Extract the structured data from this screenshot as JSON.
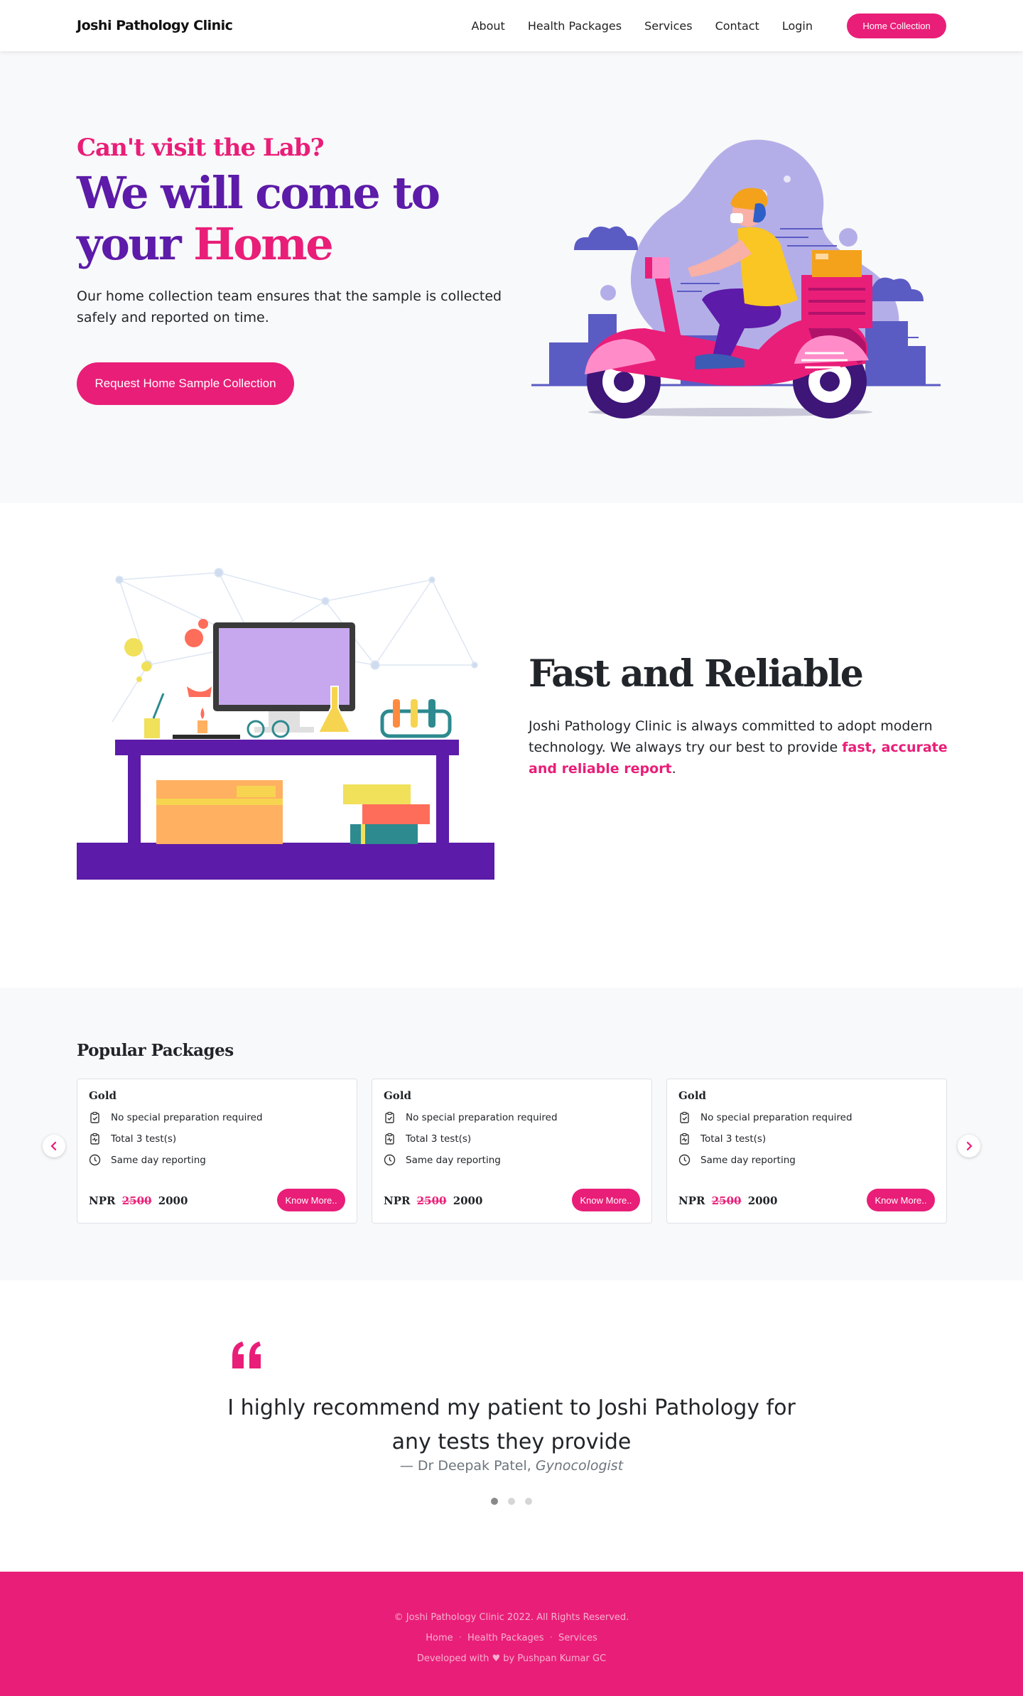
{
  "brand": "Joshi Pathology Clinic",
  "nav": {
    "items": [
      {
        "label": "About"
      },
      {
        "label": "Health Packages"
      },
      {
        "label": "Services"
      },
      {
        "label": "Contact"
      },
      {
        "label": "Login"
      }
    ],
    "cta_label": "Home Collection"
  },
  "hero": {
    "subtitle": "Can't visit the Lab?",
    "title_line1": "We will come to",
    "title_line2_a": "your ",
    "title_line2_b": "Home",
    "description": "Our home collection team ensures that the sample is collected safely and reported on time.",
    "button_label": "Request Home Sample Collection"
  },
  "fast": {
    "title": "Fast and Reliable",
    "desc_before": "Joshi Pathology Clinic is always committed to adopt modern technology. We always try our best to provide ",
    "desc_highlight": "fast, accurate and reliable report",
    "desc_after": "."
  },
  "packages": {
    "heading": "Popular Packages",
    "cards": [
      {
        "title": "Gold",
        "features": [
          "No special preparation required",
          "Total 3 test(s)",
          "Same day reporting"
        ],
        "currency": "NPR",
        "old_price": "2500",
        "price": "2000",
        "button_label": "Know More.."
      },
      {
        "title": "Gold",
        "features": [
          "No special preparation required",
          "Total 3 test(s)",
          "Same day reporting"
        ],
        "currency": "NPR",
        "old_price": "2500",
        "price": "2000",
        "button_label": "Know More.."
      },
      {
        "title": "Gold",
        "features": [
          "No special preparation required",
          "Total 3 test(s)",
          "Same day reporting"
        ],
        "currency": "NPR",
        "old_price": "2500",
        "price": "2000",
        "button_label": "Know More.."
      }
    ],
    "icons": [
      "clipboard-check-icon",
      "clipboard-pulse-icon",
      "clock-icon",
      "chevron-left-icon",
      "chevron-right-icon"
    ]
  },
  "testimonial": {
    "quote": "I highly recommend my patient to Joshi Pathology for any tests they provide",
    "author_prefix": "— Dr Deepak Patel, ",
    "author_role": "Gynocologist",
    "slide_count": 3,
    "active_slide": 1
  },
  "footer": {
    "copyright": "© Joshi Pathology Clinic 2022. All Rights Reserved.",
    "links": [
      {
        "label": "Home"
      },
      {
        "label": "Health Packages"
      },
      {
        "label": "Services"
      }
    ],
    "separator": "·",
    "credit": "Developed with ♥ by Pushpan Kumar GC"
  },
  "colors": {
    "accent": "#e91e78",
    "purple": "#5c1ba8",
    "background_light": "#f8f9fa",
    "text": "#212529"
  }
}
